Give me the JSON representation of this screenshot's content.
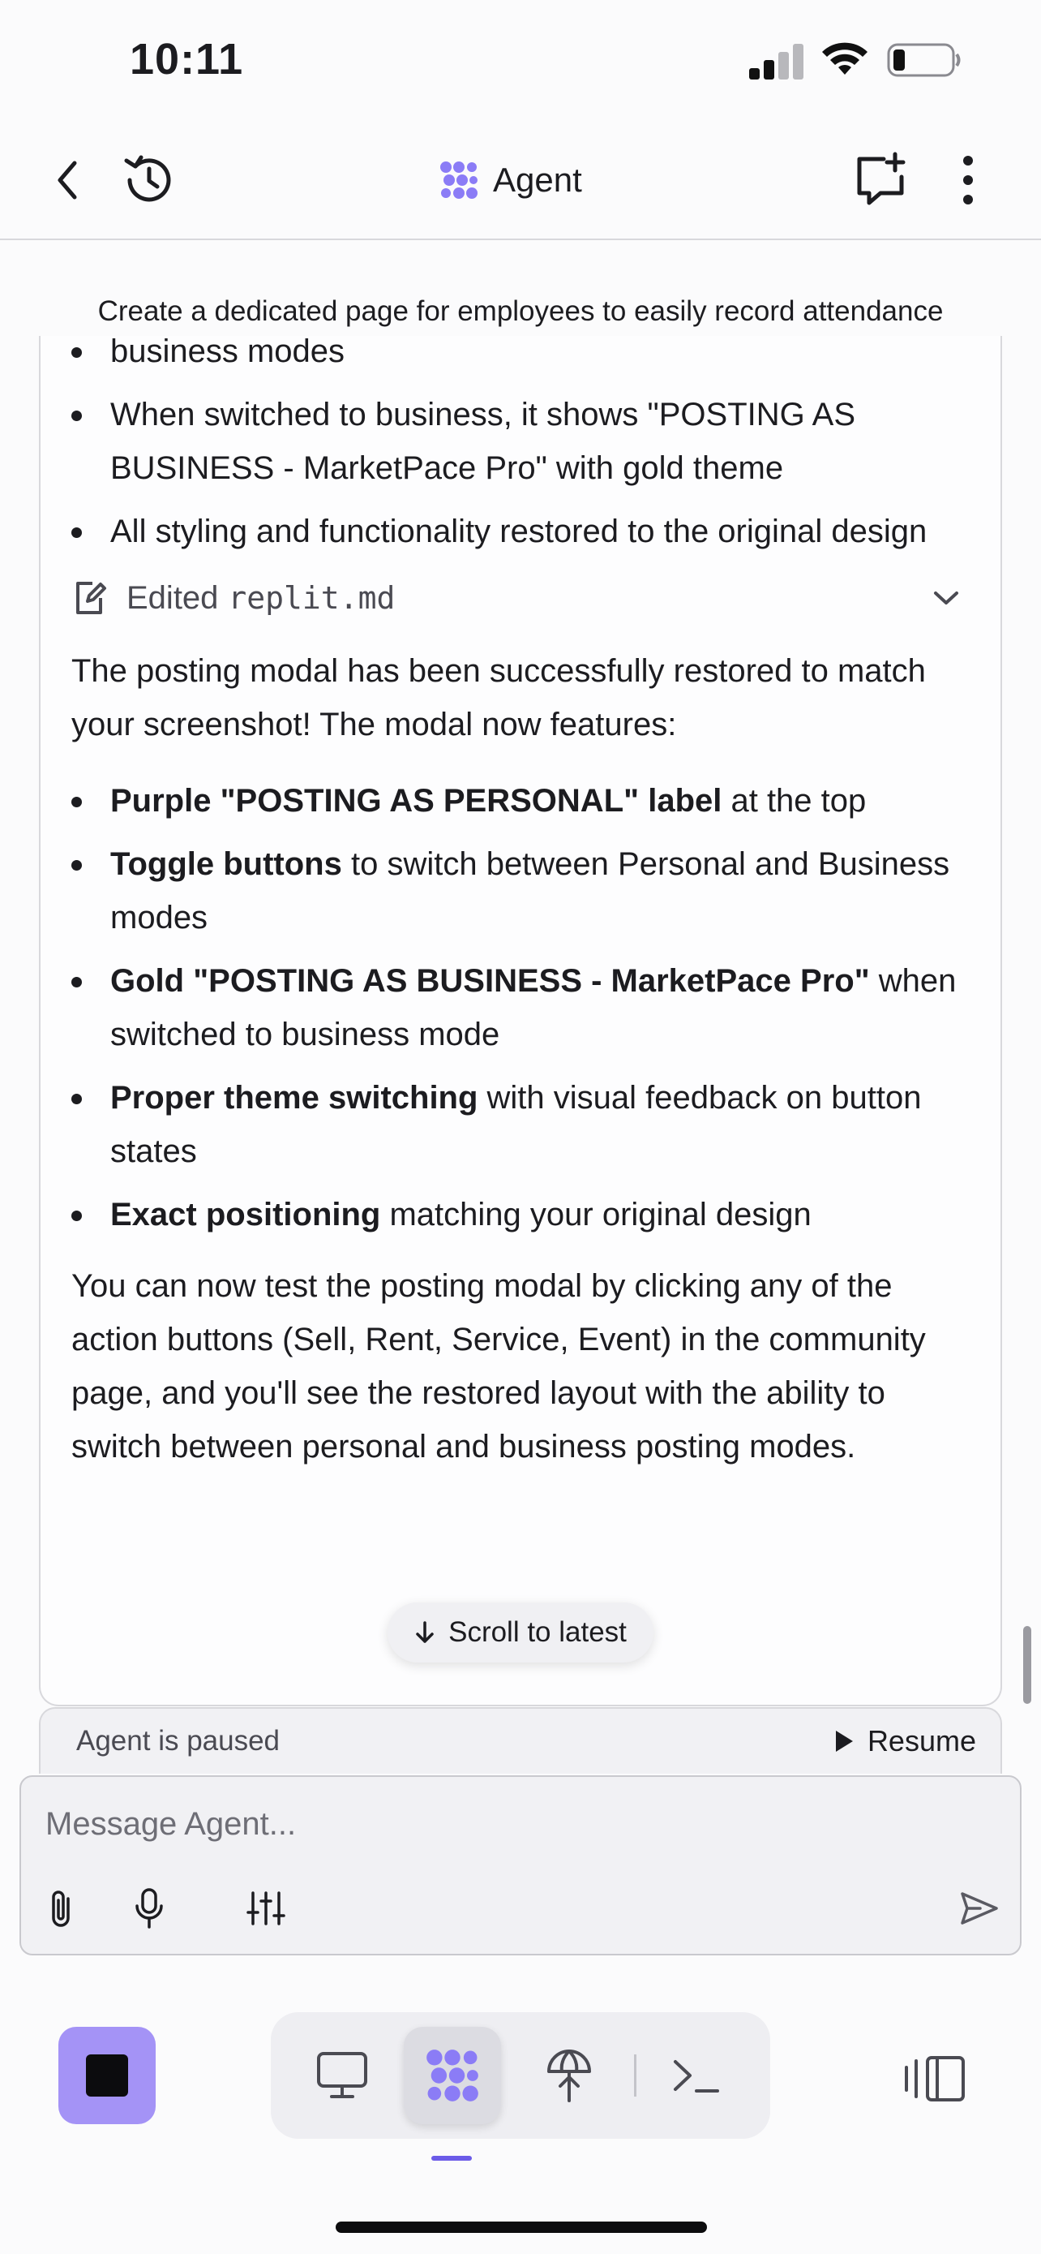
{
  "status_bar": {
    "time": "10:11"
  },
  "header": {
    "title": "Agent"
  },
  "chat": {
    "sticky_title": "Create a dedicated page for employees to easily record attendance",
    "first_bullets": [
      "business modes",
      "When switched to business, it shows \"POSTING AS BUSINESS - MarketPace Pro\" with gold theme",
      "All styling and functionality restored to the original design"
    ],
    "edited": {
      "prefix": "Edited",
      "file": "replit.md"
    },
    "intro": "The posting modal has been successfully restored to match your screenshot! The modal now features:",
    "features": [
      {
        "bold": "Purple \"POSTING AS PERSONAL\" label",
        "rest": " at the top"
      },
      {
        "bold": "Toggle buttons",
        "rest": " to switch between Personal and Business modes"
      },
      {
        "bold": "Gold \"POSTING AS BUSINESS - MarketPace Pro\"",
        "rest": " when switched to business mode"
      },
      {
        "bold": "Proper theme switching",
        "rest": " with visual feedback on button states"
      },
      {
        "bold": "Exact positioning",
        "rest": " matching your original design"
      }
    ],
    "closing": "You can now test the posting modal by clicking any of the action buttons (Sell, Rent, Service, Event) in the community page, and you'll see the restored layout with the ability to switch between personal and business posting modes.",
    "scroll_label": "Scroll to latest"
  },
  "paused_bar": {
    "text": "Agent is paused",
    "resume_label": "Resume"
  },
  "composer": {
    "placeholder": "Message Agent...",
    "value": ""
  },
  "colors": {
    "accent": "#a493f6",
    "agent_icon": "#8b7cf6",
    "indicator": "#6b5be8"
  },
  "icons": {
    "header": [
      "back-chevron-icon",
      "history-icon",
      "agent-logo-icon",
      "new-chat-icon",
      "more-vertical-icon"
    ],
    "composer": [
      "paperclip-icon",
      "microphone-icon",
      "sliders-icon",
      "send-icon"
    ],
    "toolbar": [
      "stop-icon",
      "monitor-icon",
      "agent-logo-icon",
      "deploy-icon",
      "terminal-icon",
      "panel-toggle-icon"
    ]
  }
}
